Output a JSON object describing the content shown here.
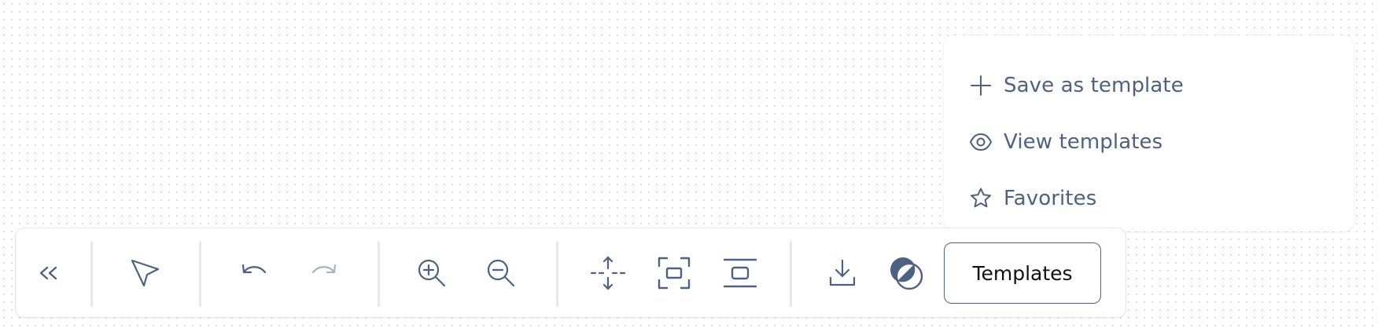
{
  "colors": {
    "icon": "#4d6283",
    "icon_disabled": "#a6b3c4",
    "text_dark": "#111111",
    "border": "#e4e7eb"
  },
  "menu": {
    "items": [
      {
        "label": "Save as template",
        "icon": "plus-icon"
      },
      {
        "label": "View templates",
        "icon": "eye-icon"
      },
      {
        "label": "Favorites",
        "icon": "star-icon"
      }
    ]
  },
  "toolbar": {
    "collapse_icon": "chevrons-left-icon",
    "pointer_icon": "pointer-icon",
    "undo_icon": "undo-icon",
    "redo_icon": "redo-icon",
    "redo_disabled": true,
    "zoom_in_icon": "zoom-in-icon",
    "zoom_out_icon": "zoom-out-icon",
    "move_icon": "move-vertical-icon",
    "fit_icon": "fit-view-icon",
    "center_icon": "center-align-icon",
    "download_icon": "download-icon",
    "theme_icon": "theme-circles-icon",
    "templates_label": "Templates"
  }
}
